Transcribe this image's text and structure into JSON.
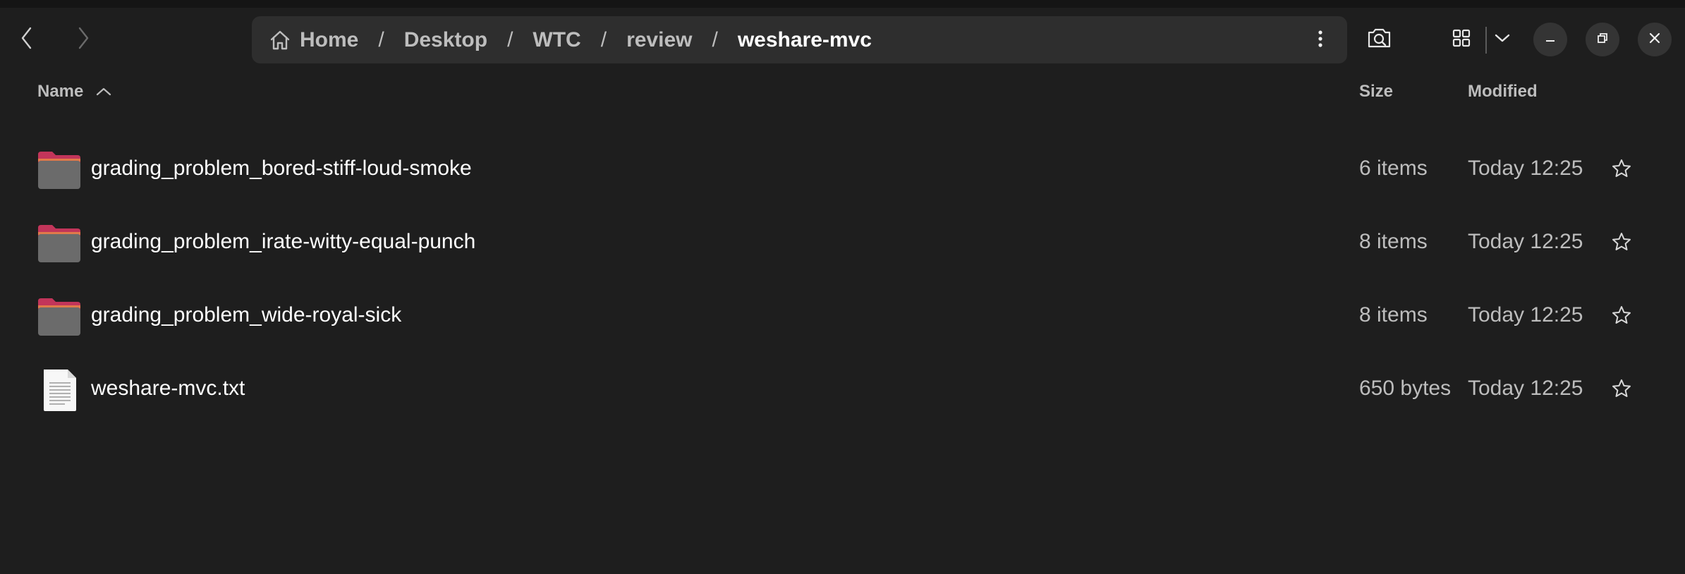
{
  "breadcrumb": [
    {
      "label": "Home"
    },
    {
      "label": "Desktop"
    },
    {
      "label": "WTC"
    },
    {
      "label": "review"
    },
    {
      "label": "weshare-mvc"
    }
  ],
  "columns": {
    "name": "Name",
    "size": "Size",
    "modified": "Modified"
  },
  "files": [
    {
      "name": "grading_problem_bored-stiff-loud-smoke",
      "size": "6 items",
      "modified": "Today 12:25",
      "type": "folder"
    },
    {
      "name": "grading_problem_irate-witty-equal-punch",
      "size": "8 items",
      "modified": "Today 12:25",
      "type": "folder"
    },
    {
      "name": "grading_problem_wide-royal-sick",
      "size": "8 items",
      "modified": "Today 12:25",
      "type": "folder"
    },
    {
      "name": "weshare-mvc.txt",
      "size": "650 bytes",
      "modified": "Today 12:25",
      "type": "text-file"
    }
  ],
  "icons": {
    "back": "chevron-left-icon",
    "forward": "chevron-right-icon",
    "home": "home-icon",
    "path_menu": "vertical-dots-icon",
    "search": "search-icon",
    "view_grid": "grid-icon",
    "view_options": "chevron-down-icon",
    "minimize": "minimize-icon",
    "maximize": "restore-icon",
    "close": "close-icon",
    "star": "star-outline-icon",
    "sort": "chevron-up-icon"
  },
  "colors": {
    "background": "#1e1e1e",
    "pathbar": "#2e2e2e",
    "folder_tab": "#c2355a",
    "folder_body": "#6b6b6b",
    "text_primary": "#ffffff",
    "text_secondary": "#bdbdbd"
  }
}
